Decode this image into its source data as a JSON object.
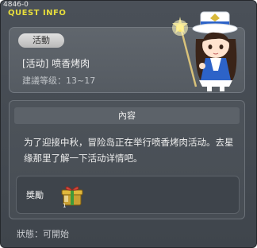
{
  "window": {
    "id": "4846-0",
    "title": "QUEST INFO"
  },
  "quest": {
    "category": "活動",
    "name": "[活动] 喷香烤肉",
    "level": "建議等级：13~17"
  },
  "content": {
    "header": "內容",
    "description": "为了迎接中秋，冒险岛正在举行喷香烤肉活动。去星缘那里了解一下活动详情吧。",
    "reward_label": "獎勵",
    "reward_icon": "gift-box-icon"
  },
  "status": "狀態：可開始",
  "npc_icon": "npc-star-girl",
  "colors": {
    "title": "#e8de3c",
    "panel": "#555b62",
    "text": "#eeeeee"
  }
}
